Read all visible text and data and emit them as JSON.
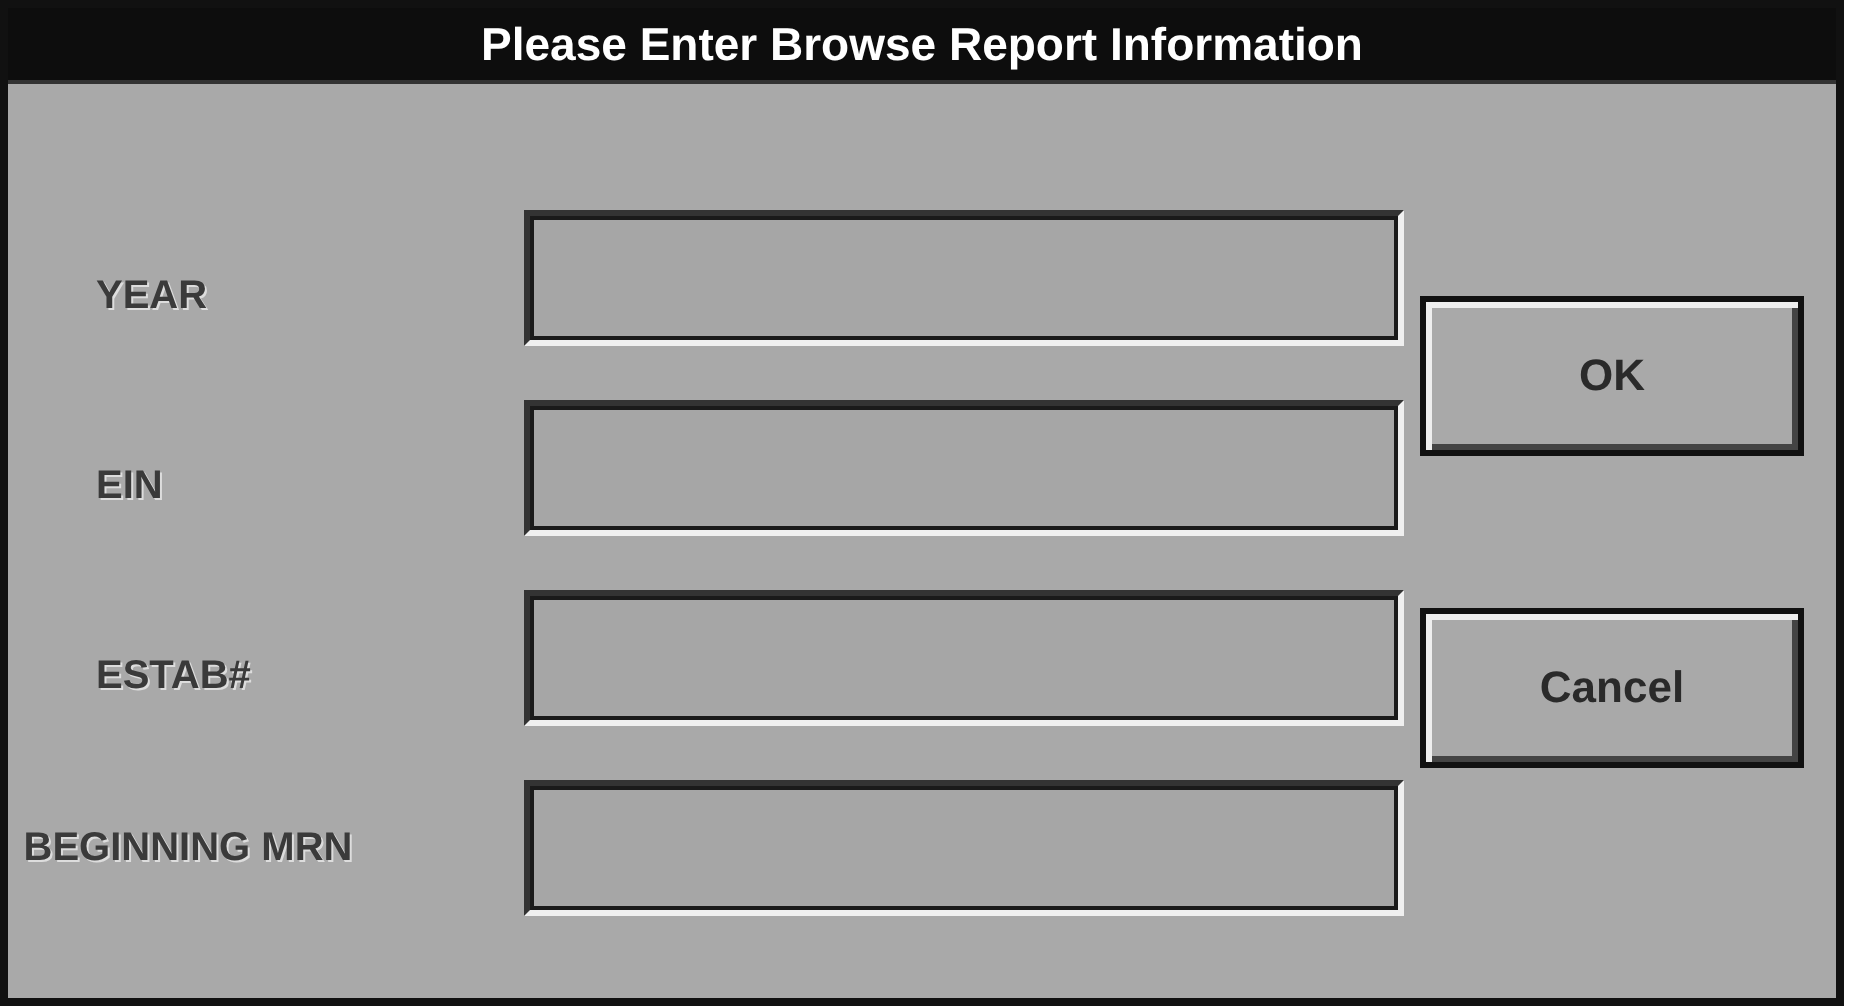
{
  "window": {
    "title": "Please Enter Browse Report Information"
  },
  "fields": [
    {
      "label": "YEAR"
    },
    {
      "label": "EIN"
    },
    {
      "label": "ESTAB#"
    },
    {
      "label": "BEGINNING MRN"
    }
  ],
  "buttons": [
    "OK",
    "Cancel"
  ]
}
